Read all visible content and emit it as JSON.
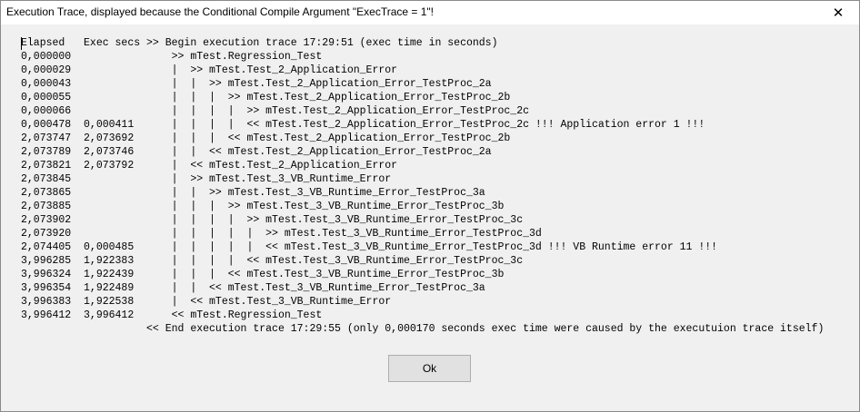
{
  "window": {
    "title": "Execution Trace, displayed because the Conditional Compile Argument \"ExecTrace = 1\"!",
    "close_icon": "close-icon",
    "close_glyph": "✕"
  },
  "trace": {
    "lines": [
      "Elapsed   Exec secs >> Begin execution trace 17:29:51 (exec time in seconds)",
      "0,000000                >> mTest.Regression_Test",
      "0,000029                |  >> mTest.Test_2_Application_Error",
      "0,000043                |  |  >> mTest.Test_2_Application_Error_TestProc_2a",
      "0,000055                |  |  |  >> mTest.Test_2_Application_Error_TestProc_2b",
      "0,000066                |  |  |  |  >> mTest.Test_2_Application_Error_TestProc_2c",
      "0,000478  0,000411      |  |  |  |  << mTest.Test_2_Application_Error_TestProc_2c !!! Application error 1 !!!",
      "2,073747  2,073692      |  |  |  << mTest.Test_2_Application_Error_TestProc_2b",
      "2,073789  2,073746      |  |  << mTest.Test_2_Application_Error_TestProc_2a",
      "2,073821  2,073792      |  << mTest.Test_2_Application_Error",
      "2,073845                |  >> mTest.Test_3_VB_Runtime_Error",
      "2,073865                |  |  >> mTest.Test_3_VB_Runtime_Error_TestProc_3a",
      "2,073885                |  |  |  >> mTest.Test_3_VB_Runtime_Error_TestProc_3b",
      "2,073902                |  |  |  |  >> mTest.Test_3_VB_Runtime_Error_TestProc_3c",
      "2,073920                |  |  |  |  |  >> mTest.Test_3_VB_Runtime_Error_TestProc_3d",
      "2,074405  0,000485      |  |  |  |  |  << mTest.Test_3_VB_Runtime_Error_TestProc_3d !!! VB Runtime error 11 !!!",
      "3,996285  1,922383      |  |  |  |  << mTest.Test_3_VB_Runtime_Error_TestProc_3c",
      "3,996324  1,922439      |  |  |  << mTest.Test_3_VB_Runtime_Error_TestProc_3b",
      "3,996354  1,922489      |  |  << mTest.Test_3_VB_Runtime_Error_TestProc_3a",
      "3,996383  1,922538      |  << mTest.Test_3_VB_Runtime_Error",
      "3,996412  3,996412      << mTest.Regression_Test",
      "                    << End execution trace 17:29:55 (only 0,000170 seconds exec time were caused by the executuion trace itself)"
    ]
  },
  "buttons": {
    "ok_label": "Ok"
  }
}
